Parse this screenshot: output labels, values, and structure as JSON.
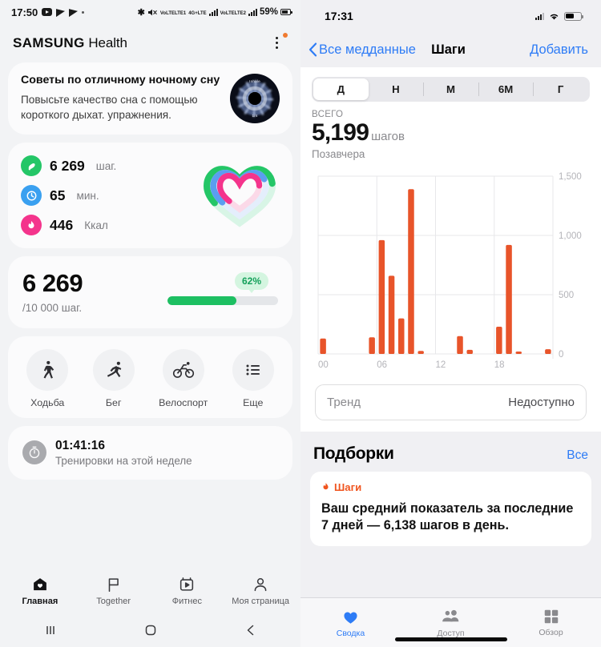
{
  "android": {
    "status_bar": {
      "time": "17:50",
      "battery_percent": "59%",
      "network_1": "LTE1",
      "network_2": "LTE2",
      "network_label": "4G+",
      "volte": "VoLTE",
      "icons": [
        "youtube-icon",
        "telegram-icon",
        "telegram-icon",
        "dot-icon",
        "bluetooth-icon",
        "mute-icon",
        "signal-icon",
        "battery-icon"
      ]
    },
    "header": {
      "brand": "SAMSUNG",
      "app": "Health",
      "menu_icon": "kebab-menu-icon"
    },
    "tip_card": {
      "title": "Советы по отличному ночному сну",
      "subtitle": "Повысьте качество сна с помощью короткого дыхат. упражнения.",
      "thumb_top": "Inhale",
      "thumb_bottom": "1/4"
    },
    "metrics": [
      {
        "icon": "steps-shoe-icon",
        "value": "6 269",
        "unit": "шаг.",
        "color": "#24c667"
      },
      {
        "icon": "clock-icon",
        "value": "65",
        "unit": "мин.",
        "color": "#3aa0f0"
      },
      {
        "icon": "flame-icon",
        "value": "446",
        "unit": "Ккал",
        "color": "#f4348c"
      }
    ],
    "steps_card": {
      "value": "6 269",
      "goal": "/10 000 шаг.",
      "percent_label": "62%",
      "percent": 62,
      "bar_color": "#1dbf62",
      "badge_bg": "#d4f5e0"
    },
    "activities": [
      {
        "icon": "walking-icon",
        "label": "Ходьба"
      },
      {
        "icon": "running-icon",
        "label": "Бег"
      },
      {
        "icon": "cycling-icon",
        "label": "Велоспорт"
      },
      {
        "icon": "list-more-icon",
        "label": "Еще"
      }
    ],
    "workout_card": {
      "icon": "stopwatch-icon",
      "time": "01:41:16",
      "subtitle": "Тренировки на этой неделе"
    },
    "bottom_nav": [
      {
        "icon": "home-heart-icon",
        "label": "Главная",
        "active": true
      },
      {
        "icon": "flag-icon",
        "label": "Together",
        "active": false
      },
      {
        "icon": "fitness-video-icon",
        "label": "Фитнес",
        "active": false
      },
      {
        "icon": "person-icon",
        "label": "Моя страница",
        "active": false
      }
    ],
    "system_nav": [
      "recents-icon",
      "home-icon",
      "back-icon"
    ]
  },
  "ios": {
    "status_bar": {
      "time": "17:31",
      "icons": [
        "cellular-icon",
        "wifi-icon",
        "battery-icon"
      ]
    },
    "navbar": {
      "back_label": "Все медданные",
      "title": "Шаги",
      "action_label": "Добавить",
      "back_icon": "chevron-left-icon"
    },
    "segments": [
      {
        "label": "Д",
        "active": true
      },
      {
        "label": "Н",
        "active": false
      },
      {
        "label": "М",
        "active": false
      },
      {
        "label": "6М",
        "active": false
      },
      {
        "label": "Г",
        "active": false
      }
    ],
    "summary": {
      "total_label": "ВСЕГО",
      "total_value": "5,199",
      "total_unit": "шагов",
      "date_label": "Позавчера"
    },
    "trend": {
      "label": "Тренд",
      "value": "Недоступно"
    },
    "highlights": {
      "section_title": "Подборки",
      "all_label": "Все",
      "card": {
        "tag_icon": "flame-icon",
        "tag": "Шаги",
        "text": "Ваш средний показатель за последние 7 дней — 6,138 шагов в день."
      }
    },
    "tabbar": [
      {
        "icon": "heart-icon",
        "label": "Сводка",
        "active": true
      },
      {
        "icon": "people-icon",
        "label": "Доступ",
        "active": false
      },
      {
        "icon": "grid-icon",
        "label": "Обзор",
        "active": false
      }
    ]
  },
  "chart_data": {
    "type": "bar",
    "title": "Шаги",
    "subtitle": "Позавчера",
    "xlabel": "",
    "ylabel": "",
    "bar_color": "#e8542a",
    "grid": true,
    "legend": false,
    "ylim": [
      0,
      1500
    ],
    "yticks": [
      0,
      500,
      1000,
      1500
    ],
    "ytick_labels": [
      "0",
      "500",
      "1,000",
      "1,500"
    ],
    "xticks": [
      0,
      6,
      12,
      18
    ],
    "xtick_labels": [
      "00",
      "06",
      "12",
      "18"
    ],
    "x": [
      0,
      1,
      2,
      3,
      4,
      5,
      6,
      7,
      8,
      9,
      10,
      11,
      12,
      13,
      14,
      15,
      16,
      17,
      18,
      19,
      20,
      21,
      22,
      23
    ],
    "values": [
      130,
      0,
      0,
      0,
      0,
      140,
      960,
      660,
      300,
      1390,
      25,
      0,
      0,
      0,
      150,
      35,
      0,
      0,
      230,
      920,
      12,
      0,
      0,
      40
    ],
    "total": 5199,
    "unit": "шагов"
  }
}
